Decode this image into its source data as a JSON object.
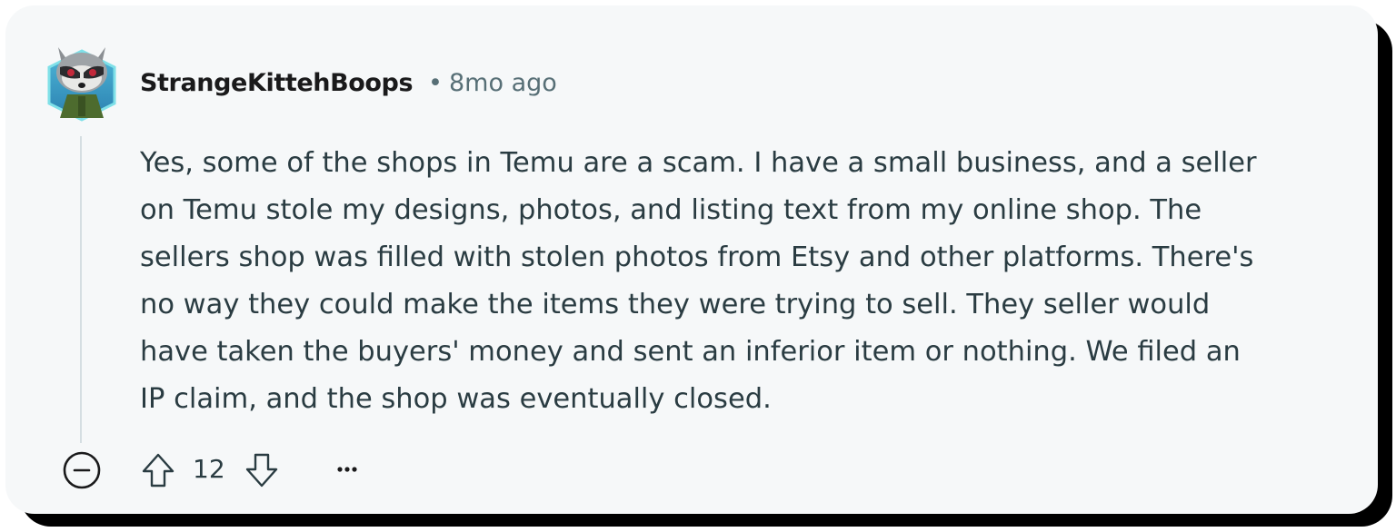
{
  "comment": {
    "author": "StrangeKittehBoops",
    "separator": "•",
    "time": "8mo ago",
    "body_lines": [
      "Yes, some of the shops in Temu are a scam. I have a small business, and a seller",
      "on Temu stole my designs, photos, and listing text from my online shop. The",
      "sellers shop was filled with stolen photos from Etsy and other platforms. There's",
      "no way they could make the items they were trying to sell. They seller would",
      "have taken the buyers' money and sent an inferior item or nothing. We filed an",
      "IP claim, and the shop was eventually closed."
    ],
    "score": "12"
  },
  "icons": {
    "avatar": "raccoon-avatar-icon",
    "collapse": "minus-circle-icon",
    "upvote": "arrow-up-icon",
    "downvote": "arrow-down-icon",
    "more": "ellipsis-icon"
  },
  "colors": {
    "card_background": "#f6f8f9",
    "shadow": "#000000",
    "author": "#1a1a1b",
    "meta": "#576f76",
    "body": "#2a3c42",
    "thread_line": "#d5dee2"
  }
}
